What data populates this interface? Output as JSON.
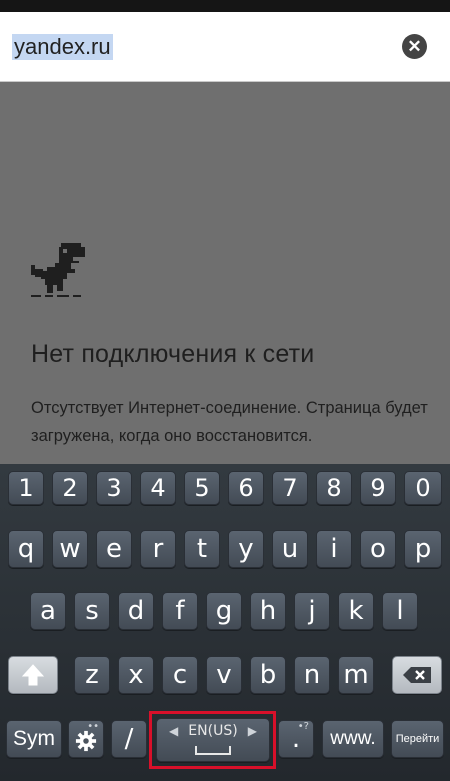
{
  "url_bar": {
    "url_text": "yandex.ru",
    "clear_icon": "close-circle-icon"
  },
  "error_page": {
    "icon": "offline-dino-icon",
    "title": "Нет подключения к сети",
    "message": "Отсутствует Интернет-соединение. Страница будет загружена, когда оно восстановится."
  },
  "keyboard": {
    "number_row": [
      "1",
      "2",
      "3",
      "4",
      "5",
      "6",
      "7",
      "8",
      "9",
      "0"
    ],
    "row1": [
      "q",
      "w",
      "e",
      "r",
      "t",
      "y",
      "u",
      "i",
      "o",
      "p"
    ],
    "row2": [
      "a",
      "s",
      "d",
      "f",
      "g",
      "h",
      "j",
      "k",
      "l"
    ],
    "row3": [
      "z",
      "x",
      "c",
      "v",
      "b",
      "n",
      "m"
    ],
    "shift_icon": "shift-arrow-icon",
    "backspace_icon": "backspace-icon",
    "sym_label": "Sym",
    "settings_icon": "gear-icon",
    "slash_label": "/",
    "space_label": "EN(US)",
    "period_label": ".",
    "www_label": "www.",
    "go_label": "Перейти",
    "highlight_color": "#d8102a"
  }
}
